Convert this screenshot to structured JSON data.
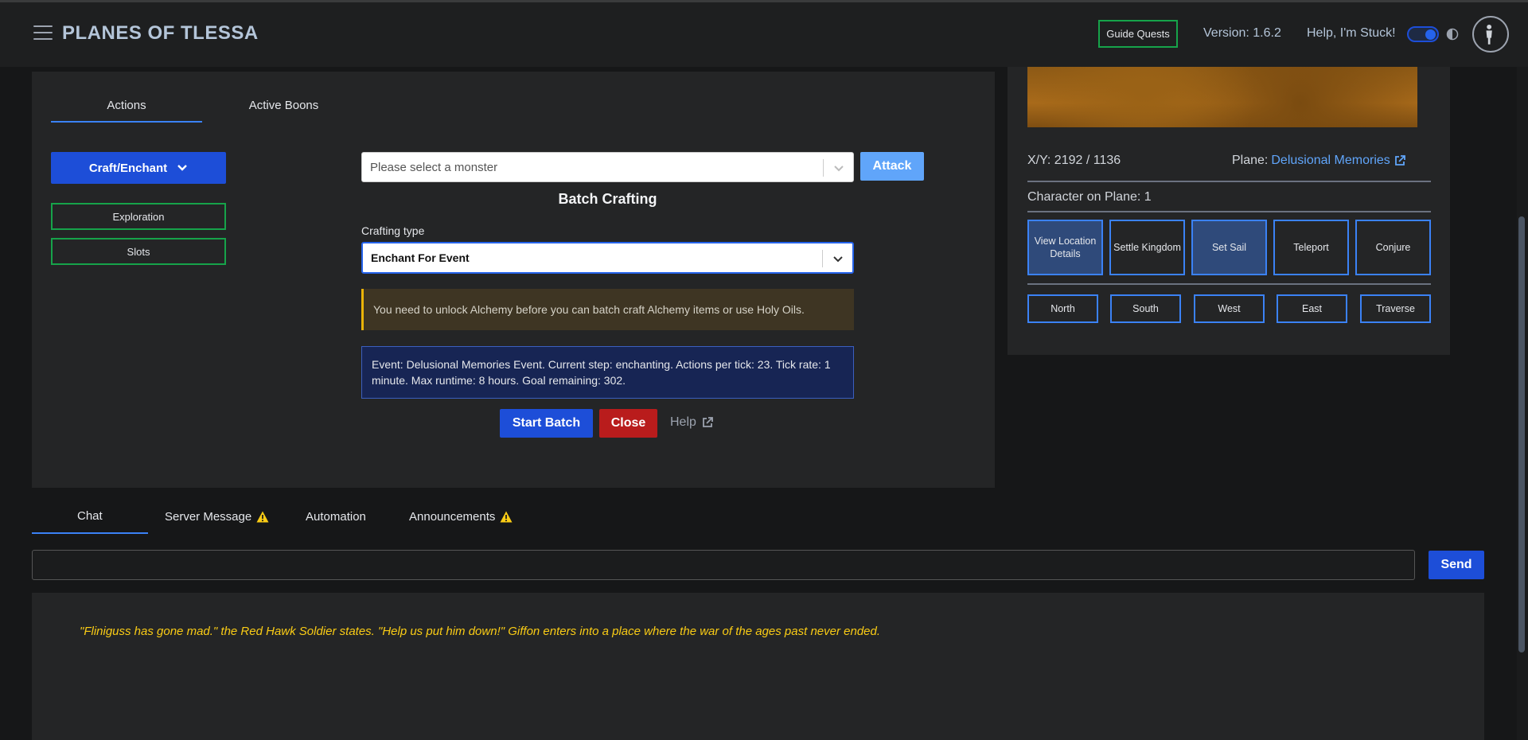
{
  "header": {
    "title": "PLANES OF TLESSA",
    "guide_quests_label": "Guide Quests",
    "version": "Version: 1.6.2",
    "help_stuck": "Help, I'm Stuck!"
  },
  "actions": {
    "tabs": [
      "Actions",
      "Active Boons"
    ],
    "craft_enchant_label": "Craft/Enchant",
    "exploration_label": "Exploration",
    "slots_label": "Slots",
    "monster_placeholder": "Please select a monster",
    "attack_label": "Attack",
    "batch_title": "Batch Crafting",
    "crafting_type_label": "Crafting type",
    "crafting_type_value": "Enchant For Event",
    "warning": "You need to unlock Alchemy before you can batch craft Alchemy items or use Holy Oils.",
    "event_info": "Event: Delusional Memories Event. Current step: enchanting. Actions per tick: 23. Tick rate: 1 minute. Max runtime: 8 hours. Goal remaining: 302.",
    "start_batch_label": "Start Batch",
    "close_label": "Close",
    "help_label": "Help"
  },
  "map": {
    "coords": "X/Y: 2192 / 1136",
    "plane_prefix": "Plane:",
    "plane_name": "Delusional Memories",
    "character_on_plane": "Character on Plane: 1",
    "buttons": [
      "View Location Details",
      "Settle Kingdom",
      "Set Sail",
      "Teleport",
      "Conjure"
    ],
    "directions": [
      "North",
      "South",
      "West",
      "East",
      "Traverse"
    ]
  },
  "chat": {
    "tabs": [
      "Chat",
      "Server Message",
      "Automation",
      "Announcements"
    ],
    "send_label": "Send",
    "message": "\"Fliniguss has gone mad.\" the Red Hawk Soldier states. \"Help us put him down!\" Giffon enters into a place where the war of the ages past never ended."
  },
  "colors": {
    "accent": "#1d4ed8",
    "success": "#16a34a",
    "danger": "#b91c1c",
    "warning": "#facc15",
    "link": "#60a5fa"
  }
}
